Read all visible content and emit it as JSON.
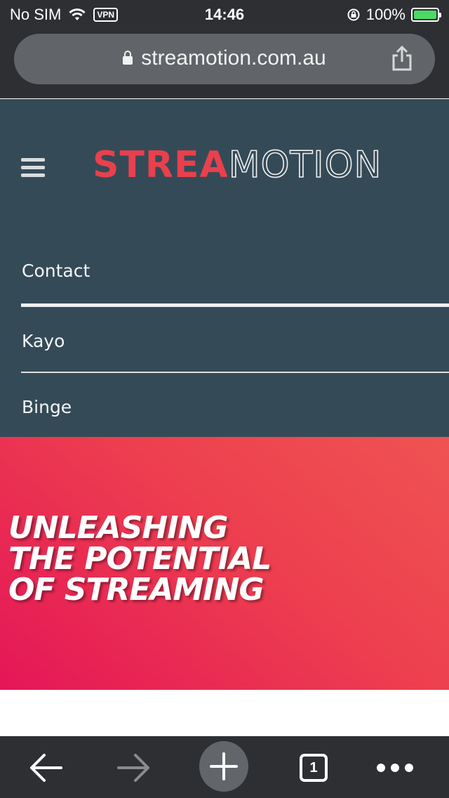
{
  "status_bar": {
    "carrier": "No SIM",
    "vpn": "VPN",
    "time": "14:46",
    "battery": "100%",
    "battery_level": 1.0,
    "icons": [
      "wifi-icon",
      "rotation-lock-icon",
      "battery-charging-icon"
    ]
  },
  "browser": {
    "url": "streamotion.com.au",
    "tab_count": "1",
    "icons": [
      "lock-icon",
      "share-icon",
      "back-icon",
      "forward-icon",
      "new-tab-icon",
      "more-icon"
    ]
  },
  "header": {
    "logo_part1": "STREA",
    "logo_part2": "MOTION",
    "icon": "hamburger-menu-icon"
  },
  "nav": {
    "items": [
      {
        "label": "Contact"
      },
      {
        "label": "Kayo"
      },
      {
        "label": "Binge"
      }
    ]
  },
  "hero": {
    "line1": "UNLEASHING",
    "line2": "THE POTENTIAL",
    "line3": "OF STREAMING"
  },
  "colors": {
    "header_bg": "#354a57",
    "brand_red": "#e9404d",
    "hero_gradient_start": "#e51657",
    "hero_gradient_end": "#ef5352",
    "browser_chrome": "#2e2f33"
  }
}
